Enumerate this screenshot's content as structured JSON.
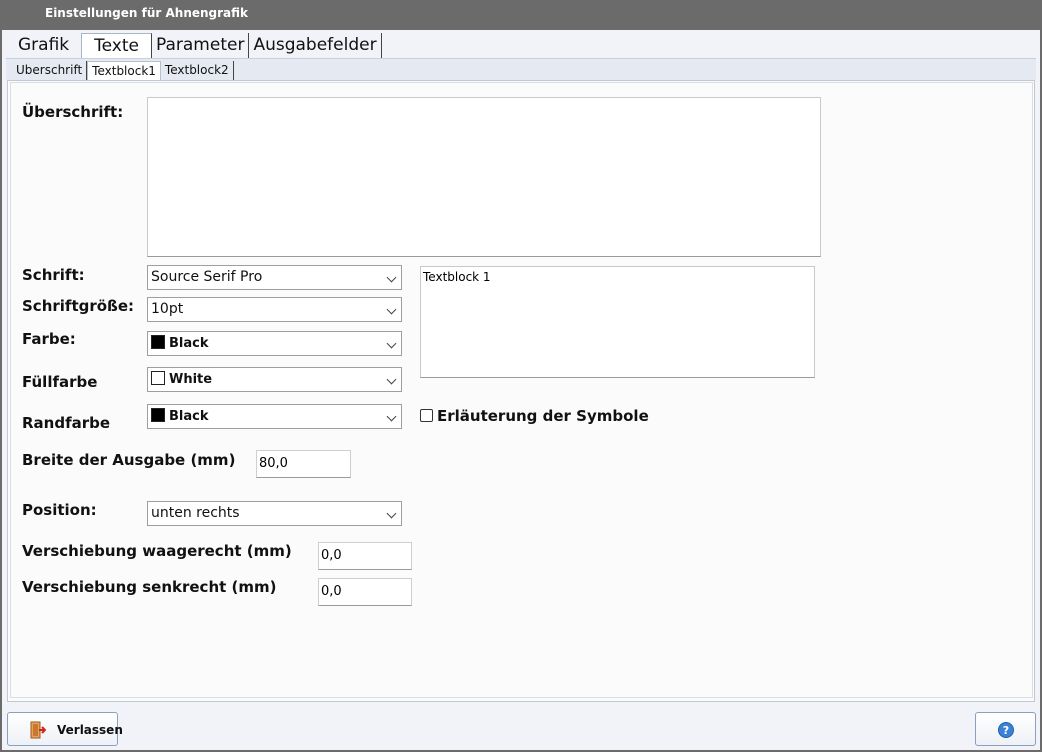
{
  "window": {
    "title": "Einstellungen für Ahnengrafik"
  },
  "main_tabs": [
    {
      "label": "Grafik"
    },
    {
      "label": "Texte",
      "active": true
    },
    {
      "label": "Parameter"
    },
    {
      "label": "Ausgabefelder"
    }
  ],
  "sub_tabs": [
    {
      "label": "Uberschrift"
    },
    {
      "label": "Textblock1",
      "active": true
    },
    {
      "label": "Textblock2"
    }
  ],
  "form": {
    "heading_label": "Überschrift:",
    "heading_value": "",
    "font_label": "Schrift:",
    "font_value": "Source Serif Pro",
    "size_label": "Schriftgröße:",
    "size_value": "10pt",
    "color_label": "Farbe:",
    "color_value": "Black",
    "color_hex": "#000000",
    "fill_label": "Füllfarbe",
    "fill_value": "White",
    "fill_hex": "#ffffff",
    "border_label": "Randfarbe",
    "border_value": "Black",
    "border_hex": "#000000",
    "preview_text": "Textblock 1",
    "legend_label": "Erläuterung der Symbole",
    "legend_checked": false,
    "width_label": "Breite der Ausgabe (mm)",
    "width_value": "80,0",
    "position_label": "Position:",
    "position_value": "unten rechts",
    "shift_h_label": "Verschiebung waagerecht (mm)",
    "shift_h_value": "0,0",
    "shift_v_label": "Verschiebung senkrecht (mm)",
    "shift_v_value": "0,0"
  },
  "footer": {
    "exit_label": "Verlassen",
    "exit_icon": "door-exit-icon",
    "help_icon": "help-icon"
  }
}
